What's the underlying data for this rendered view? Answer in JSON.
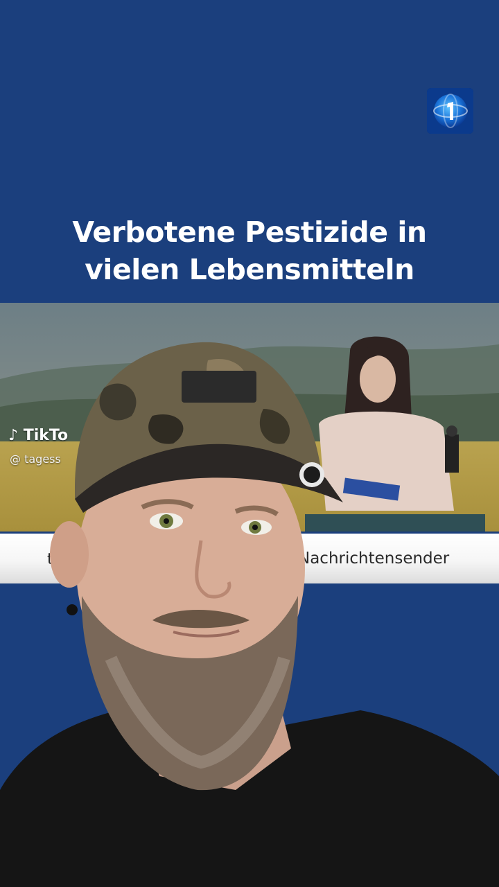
{
  "overlay": {
    "logo_icon": "tagesschau-globe-logo-icon",
    "headline_line1": "Verbotene Pestizide in",
    "headline_line2": "vielen Lebensmitteln"
  },
  "embedded_video": {
    "watermark": "TikTo",
    "handle": "@ tagess",
    "ticker_left": "ta",
    "ticker_right": "Nachrichtensender"
  },
  "colors": {
    "background": "#1b3f7d",
    "ticker_bg": "#f4f4f4"
  }
}
